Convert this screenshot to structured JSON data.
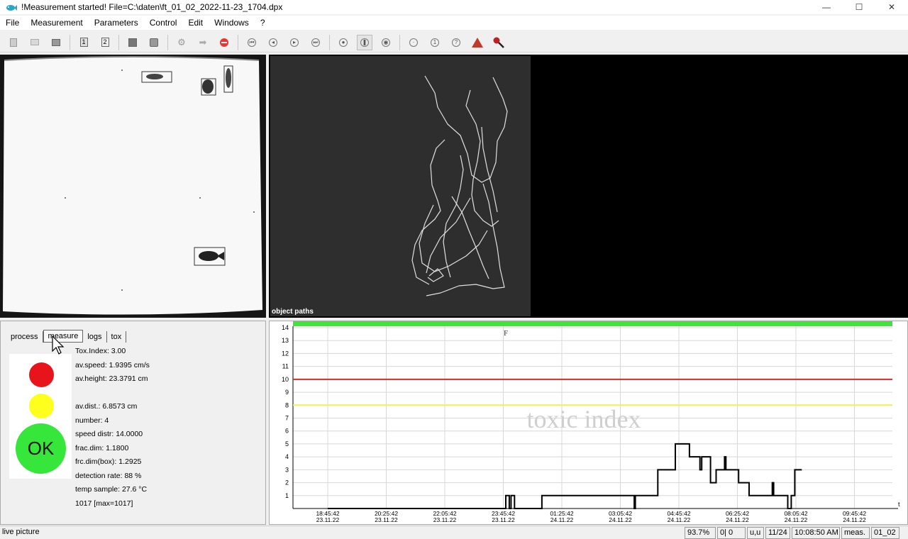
{
  "window": {
    "title": "!Measurement started! File=C:\\daten\\ft_01_02_2022-11-23_1704.dpx",
    "minimize": "—",
    "maximize": "☐",
    "close": "✕"
  },
  "menu": [
    "File",
    "Measurement",
    "Parameters",
    "Control",
    "Edit",
    "Windows",
    "?"
  ],
  "toolbar": {
    "number1": "1",
    "number2": "2",
    "circle1": "1",
    "circle2": "?",
    "warning": "!"
  },
  "paths_panel": {
    "label": "object paths"
  },
  "info_panel": {
    "tabs": [
      "process",
      "measure",
      "logs",
      "tox"
    ],
    "active_tab": "measure",
    "ok_label": "OK",
    "values": {
      "tox_index": "Tox.Index: 3.00",
      "av_speed": "av.speed: 1.9395 cm/s",
      "av_height": "av.height: 23.3791 cm",
      "av_dist": "av.dist.:  6.8573 cm",
      "number": "number:     4",
      "speed_distr": "speed distr: 14.0000",
      "frac_dim": "frac.dim: 1.1800",
      "frc_dim_box": "frc.dim(box):  1.2925",
      "detection_rate": "detection rate:  88 %",
      "temp_sample": "temp sample:  27.6 °C",
      "count": "1017 [max=1017]"
    },
    "colors": {
      "red": "#e8141c",
      "yellow": "#ffff1e",
      "green": "#36e63a"
    }
  },
  "chart_data": {
    "type": "line",
    "watermark": "toxic index",
    "flag": "F",
    "x_axis_label": "t",
    "ylim": [
      0,
      14
    ],
    "y_ticks": [
      1,
      2,
      3,
      4,
      5,
      6,
      7,
      8,
      9,
      10,
      11,
      12,
      13,
      14
    ],
    "x_ticks": [
      {
        "time": "18:45:42",
        "date": "23.11.22"
      },
      {
        "time": "20:25:42",
        "date": "23.11.22"
      },
      {
        "time": "22:05:42",
        "date": "23.11.22"
      },
      {
        "time": "23:45:42",
        "date": "23.11.22"
      },
      {
        "time": "01:25:42",
        "date": "24.11.22"
      },
      {
        "time": "03:05:42",
        "date": "24.11.22"
      },
      {
        "time": "04:45:42",
        "date": "24.11.22"
      },
      {
        "time": "06:25:42",
        "date": "24.11.22"
      },
      {
        "time": "08:05:42",
        "date": "24.11.22"
      },
      {
        "time": "09:45:42",
        "date": "24.11.22"
      }
    ],
    "thresholds": [
      {
        "value": 10,
        "color": "#dc2828"
      },
      {
        "value": 8,
        "color": "#f0f050"
      }
    ],
    "status_bar_color": "#3ee63a",
    "series": [
      {
        "color": "#000000",
        "x_hours": [
          0,
          5.07,
          5.07,
          5.17,
          5.17,
          5.22,
          5.22,
          5.32,
          5.32,
          6.1,
          6.1,
          6.13,
          6.13,
          8.73,
          8.73,
          8.76,
          8.76,
          9.4,
          9.4,
          9.9,
          9.9,
          10.3,
          10.3,
          10.6,
          10.6,
          10.65,
          10.65,
          10.9,
          10.9,
          11.06,
          11.06,
          11.3,
          11.3,
          11.34,
          11.34,
          11.7,
          11.7,
          12.0,
          12.0,
          12.66,
          12.66,
          12.7,
          12.7,
          13.1,
          13.1,
          13.2,
          13.2,
          13.3,
          13.3,
          13.5
        ],
        "values": [
          0,
          0,
          1,
          1,
          0,
          0,
          1,
          1,
          0,
          0,
          1,
          1,
          1,
          1,
          0,
          0,
          1,
          1,
          3,
          3,
          5,
          5,
          4,
          4,
          3,
          3,
          4,
          4,
          2,
          2,
          3,
          3,
          4,
          4,
          3,
          3,
          2,
          2,
          1,
          1,
          2,
          2,
          1,
          1,
          0,
          0,
          1,
          1,
          3,
          3
        ]
      }
    ]
  },
  "status": {
    "left": "live picture",
    "cells": [
      "93.7%",
      "0| 0",
      "u,u",
      "11/24",
      "10:08:50 AM",
      "meas.",
      "01_02"
    ]
  }
}
